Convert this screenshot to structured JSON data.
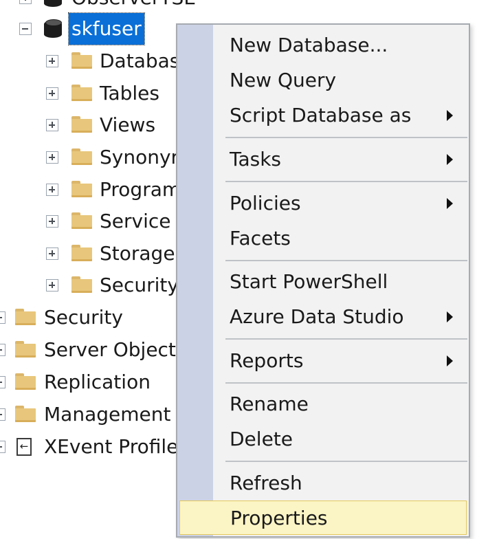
{
  "tree": {
    "top_partial_label": "ObserverTSE",
    "database": {
      "label": "skfuser",
      "children": [
        {
          "label": "Databas",
          "icon": "folder-icon"
        },
        {
          "label": "Tables",
          "icon": "folder-icon"
        },
        {
          "label": "Views",
          "icon": "folder-icon"
        },
        {
          "label": "Synonyr",
          "icon": "folder-icon"
        },
        {
          "label": "Program",
          "icon": "folder-icon"
        },
        {
          "label": "Service",
          "icon": "folder-icon"
        },
        {
          "label": "Storage",
          "icon": "folder-icon"
        },
        {
          "label": "Security",
          "icon": "folder-icon"
        }
      ]
    },
    "server_nodes": [
      {
        "label": "Security",
        "icon": "folder-icon"
      },
      {
        "label": "Server Object",
        "icon": "folder-icon"
      },
      {
        "label": "Replication",
        "icon": "folder-icon"
      },
      {
        "label": "Management",
        "icon": "folder-icon"
      },
      {
        "label": "XEvent Profile",
        "icon": "xevent-icon"
      }
    ]
  },
  "context_menu": {
    "items": [
      {
        "label": "New Database...",
        "submenu": false
      },
      {
        "label": "New Query",
        "submenu": false
      },
      {
        "label": "Script Database as",
        "submenu": true
      },
      {
        "label": "Tasks",
        "submenu": true
      },
      {
        "label": "Policies",
        "submenu": true
      },
      {
        "label": "Facets",
        "submenu": false
      },
      {
        "label": "Start PowerShell",
        "submenu": false
      },
      {
        "label": "Azure Data Studio",
        "submenu": true
      },
      {
        "label": "Reports",
        "submenu": true
      },
      {
        "label": "Rename",
        "submenu": false
      },
      {
        "label": "Delete",
        "submenu": false
      },
      {
        "label": "Refresh",
        "submenu": false
      },
      {
        "label": "Properties",
        "submenu": false,
        "highlighted": true
      }
    ]
  },
  "colors": {
    "selection": "#0a6fd7",
    "menu_background": "#f2f2f2",
    "menu_gutter": "#ccd2e6",
    "highlight": "#fbf4c5",
    "highlight_border": "#e4c85c"
  }
}
